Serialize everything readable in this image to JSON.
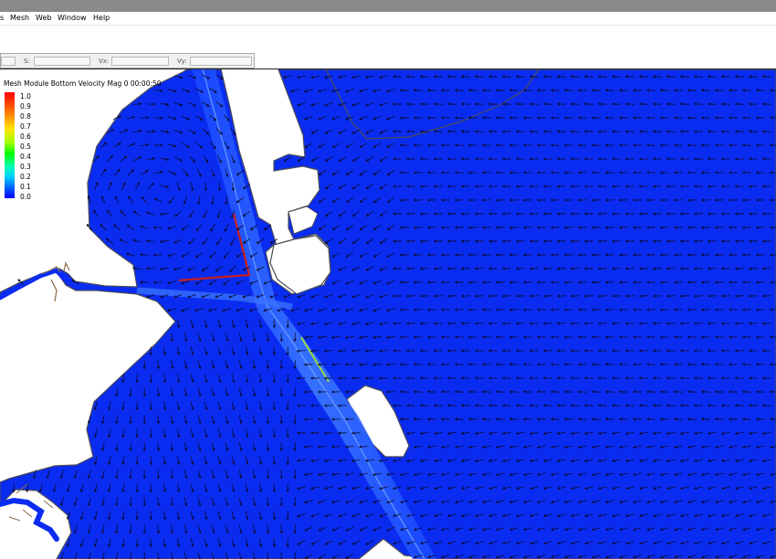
{
  "menu": {
    "items": [
      "s",
      "Mesh",
      "Web",
      "Window",
      "Help"
    ]
  },
  "coord_bar": {
    "labels": [
      "S:",
      "Vx:",
      "Vy:"
    ],
    "values": [
      "",
      "",
      ""
    ]
  },
  "legend": {
    "title": "Mesh Module Bottom Velocity Mag 0 00:00:50",
    "ticks": [
      "1.0",
      "0.9",
      "0.8",
      "0.7",
      "0.6",
      "0.5",
      "0.4",
      "0.3",
      "0.2",
      "0.1",
      "0.0"
    ]
  },
  "colors": {
    "water": "#0a2cf0",
    "channel": "#2f68ff",
    "land": "#ffffff",
    "shoreline": "#4b4b55",
    "arrow": "#0b0b2a",
    "structure_red": "#c81e1e",
    "structure_green": "#9ad84a"
  },
  "view": {
    "field": "bottom velocity magnitude",
    "time": "00:00:50"
  }
}
